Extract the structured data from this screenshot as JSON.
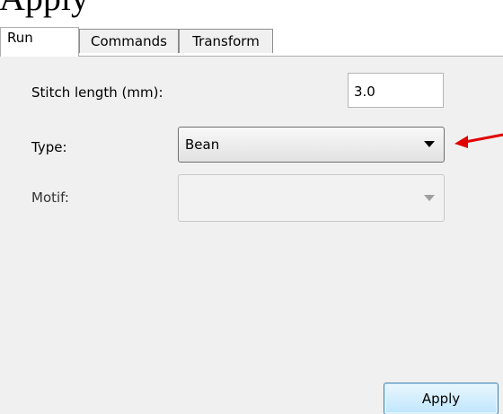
{
  "top_text": "Apply",
  "tabs": [
    {
      "label": "Run",
      "active": true
    },
    {
      "label": "Commands",
      "active": false
    },
    {
      "label": "Transform",
      "active": false
    }
  ],
  "fields": {
    "stitch_length": {
      "label": "Stitch length (mm):",
      "value": "3.0"
    },
    "type": {
      "label": "Type:",
      "value": "Bean"
    },
    "motif": {
      "label": "Motif:",
      "value": "",
      "enabled": false
    }
  },
  "apply_label": "Apply",
  "annotation": {
    "icon": "red-arrow-icon",
    "color": "#e00000"
  }
}
